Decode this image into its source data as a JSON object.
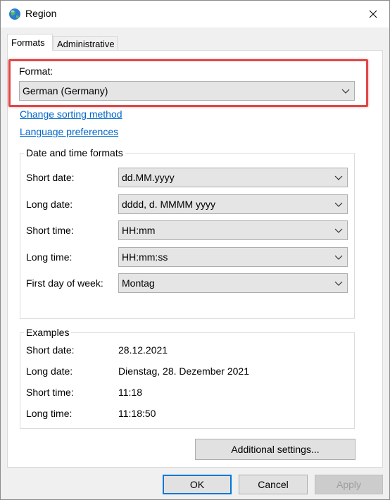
{
  "window": {
    "title": "Region",
    "icon": "globe-icon"
  },
  "tabs": [
    {
      "label": "Formats",
      "active": true
    },
    {
      "label": "Administrative",
      "active": false
    }
  ],
  "format": {
    "label": "Format:",
    "value": "German (Germany)"
  },
  "links": {
    "sorting": "Change sorting method",
    "language": "Language preferences"
  },
  "datetime": {
    "title": "Date and time formats",
    "rows": [
      {
        "label": "Short date:",
        "value": "dd.MM.yyyy"
      },
      {
        "label": "Long date:",
        "value": "dddd, d. MMMM yyyy"
      },
      {
        "label": "Short time:",
        "value": "HH:mm"
      },
      {
        "label": "Long time:",
        "value": "HH:mm:ss"
      },
      {
        "label": "First day of week:",
        "value": "Montag"
      }
    ]
  },
  "examples": {
    "title": "Examples",
    "rows": [
      {
        "label": "Short date:",
        "value": "28.12.2021"
      },
      {
        "label": "Long date:",
        "value": "Dienstag, 28. Dezember 2021"
      },
      {
        "label": "Short time:",
        "value": "11:18"
      },
      {
        "label": "Long time:",
        "value": "11:18:50"
      }
    ]
  },
  "buttons": {
    "additional": "Additional settings...",
    "ok": "OK",
    "cancel": "Cancel",
    "apply": "Apply"
  },
  "colors": {
    "highlight": "#e04848",
    "link": "#0066cc",
    "focus": "#0078d7"
  }
}
